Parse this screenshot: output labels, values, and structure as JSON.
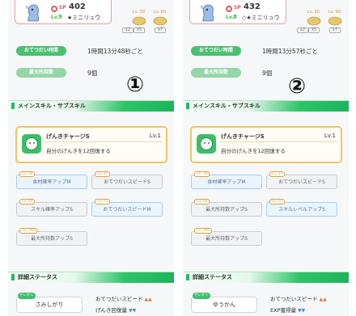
{
  "panels": [
    {
      "sp_label": "SP",
      "sp_value": "402",
      "lv_label": "Lv.",
      "lv_value": "9",
      "pokemon_name": "★ミニリュウ",
      "sub_levels": [
        "Lv. 30",
        "Lv. 60"
      ],
      "sub_badges": [
        "x2",
        "x5",
        "x7"
      ],
      "help_time_label": "おてつだい時間",
      "help_time_value": "1時間13分48秒ごと",
      "max_items_label": "最大所持数",
      "max_items_value": "9個",
      "circle_number": "①",
      "section_skill_title": "メインスキル・サブスキル",
      "main_skill_name": "げんきチャージS",
      "main_skill_lv": "Lv.1",
      "main_skill_desc": "自分のげんきを12回復する",
      "subskills": [
        {
          "badge": "Lv. 10",
          "label": "食材確率アップM"
        },
        {
          "badge": "Lv. 25",
          "label": "おてつだいスピードS"
        },
        {
          "badge": "Lv. 50",
          "label": "スキル確率アップS"
        },
        {
          "badge": "Lv. 75",
          "label": "おてつだいスピードM"
        },
        {
          "badge": "Lv. 100",
          "label": "最大所持数アップS"
        }
      ],
      "section_detail_title": "詳細ステータス",
      "nature_label": "せいかく",
      "nature_value": "さみしがり",
      "stat1": "おてつだいスピード",
      "stat1_arrow": "▲▲",
      "stat2": "げんき回復量",
      "stat2_arrow": "▼▼"
    },
    {
      "sp_label": "SP",
      "sp_value": "432",
      "lv_label": "Lv.",
      "lv_value": "8",
      "pokemon_name": "◇★ミニリュウ",
      "sub_levels": [
        "Lv. 30",
        "Lv. 60"
      ],
      "sub_badges": [
        "x2",
        "x5",
        "x7"
      ],
      "help_time_label": "おてつだい時間",
      "help_time_value": "1時間13分57秒ごと",
      "max_items_label": "最大所持数",
      "max_items_value": "9個",
      "circle_number": "②",
      "section_skill_title": "メインスキル・サブスキル",
      "main_skill_name": "げんきチャージS",
      "main_skill_lv": "Lv.1",
      "main_skill_desc": "自分のげんきを12回復する",
      "subskills": [
        {
          "badge": "Lv. 10",
          "label": "食材確率アップM"
        },
        {
          "badge": "Lv. 25",
          "label": "おてつだいスピードS"
        },
        {
          "badge": "Lv. 50",
          "label": "最大所持数アップS"
        },
        {
          "badge": "Lv. 75",
          "label": "スキルレベルアップS"
        },
        {
          "badge": "Lv. 100",
          "label": "最大所持数アップS"
        }
      ],
      "section_detail_title": "詳細ステータス",
      "nature_label": "せいかく",
      "nature_value": "ゆうかん",
      "stat1": "おてつだいスピード",
      "stat1_arrow": "▲▲",
      "stat2": "EXP獲得量",
      "stat2_arrow": "▼▼"
    }
  ],
  "colors": {
    "accent_green": "#3bbf6a",
    "gold_border": "#efc565",
    "sp_red": "#e05a5a"
  }
}
